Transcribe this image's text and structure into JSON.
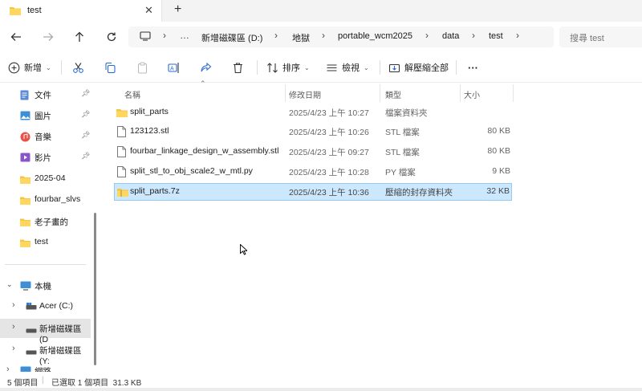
{
  "tab": {
    "title": "test",
    "new_tab": "+"
  },
  "breadcrumb": {
    "more": "…",
    "items": [
      "新增磁碟區 (D:)",
      "地獄",
      "portable_wcm2025",
      "data",
      "test"
    ]
  },
  "search": {
    "placeholder": "搜尋 test"
  },
  "toolbar": {
    "new_label": "新增",
    "sort_label": "排序",
    "view_label": "檢視",
    "extract_label": "解壓縮全部",
    "more": "···"
  },
  "sidebar": {
    "quick": [
      {
        "label": "文件",
        "icon": "document-icon",
        "pinned": true
      },
      {
        "label": "圖片",
        "icon": "picture-icon",
        "pinned": true
      },
      {
        "label": "音樂",
        "icon": "music-icon",
        "pinned": true
      },
      {
        "label": "影片",
        "icon": "video-icon",
        "pinned": true
      },
      {
        "label": "2025-04",
        "icon": "folder-icon",
        "pinned": false
      },
      {
        "label": "fourbar_slvs",
        "icon": "folder-icon",
        "pinned": false
      },
      {
        "label": "老子畫的",
        "icon": "folder-icon",
        "pinned": false
      },
      {
        "label": "test",
        "icon": "folder-icon",
        "pinned": false
      }
    ],
    "this_pc": "本機",
    "drives": [
      {
        "label": "Acer (C:)",
        "selected": false
      },
      {
        "label": "新增磁碟區 (D",
        "selected": true
      },
      {
        "label": "新增磁碟區 (Y:",
        "selected": false
      }
    ],
    "network": "網路"
  },
  "columns": {
    "name": "名稱",
    "date": "修改日期",
    "type": "類型",
    "size": "大小"
  },
  "files": [
    {
      "name": "split_parts",
      "date": "2025/4/23 上午 10:27",
      "type": "檔案資料夾",
      "size": "",
      "icon": "folder-icon",
      "selected": false
    },
    {
      "name": "123123.stl",
      "date": "2025/4/23 上午 10:26",
      "type": "STL 檔案",
      "size": "80 KB",
      "icon": "file-icon",
      "selected": false
    },
    {
      "name": "fourbar_linkage_design_w_assembly.stl",
      "date": "2025/4/23 上午 09:27",
      "type": "STL 檔案",
      "size": "80 KB",
      "icon": "file-icon",
      "selected": false
    },
    {
      "name": "split_stl_to_obj_scale2_w_mtl.py",
      "date": "2025/4/23 上午 10:28",
      "type": "PY 檔案",
      "size": "9 KB",
      "icon": "file-icon",
      "selected": false
    },
    {
      "name": "split_parts.7z",
      "date": "2025/4/23 上午 10:36",
      "type": "壓縮的封存資料夾",
      "size": "32 KB",
      "icon": "zip-folder-icon",
      "selected": true
    }
  ],
  "status": {
    "count": "5 個項目",
    "selected": "已選取 1 個項目  31.3 KB"
  }
}
